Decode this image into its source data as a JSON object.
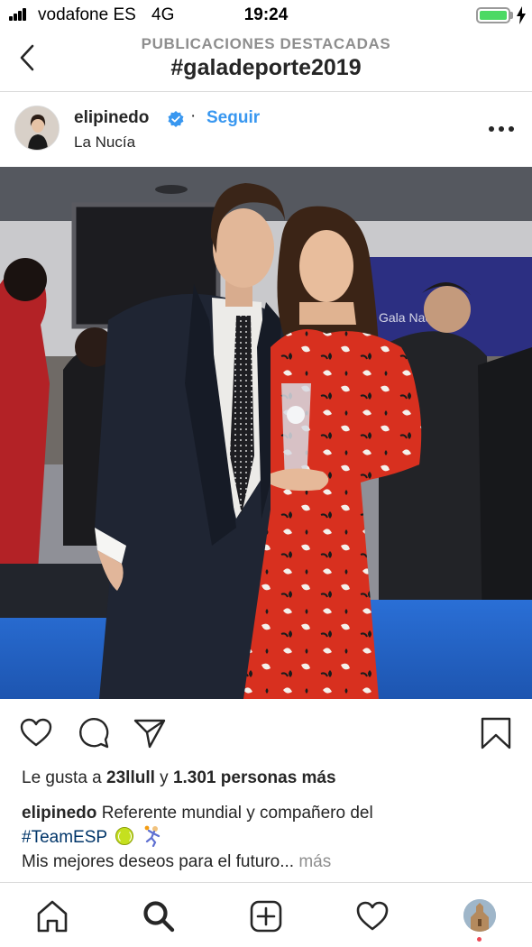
{
  "status_bar": {
    "carrier": "vodafone ES",
    "network": "4G",
    "time": "19:24",
    "battery_level": 1.0,
    "battery_color": "#4cd964"
  },
  "header": {
    "subtitle": "PUBLICACIONES DESTACADAS",
    "title": "#galadeporte2019",
    "back_icon": "chevron-left-icon"
  },
  "post": {
    "username": "elipinedo",
    "verified": true,
    "separator": "·",
    "follow_label": "Seguir",
    "location": "La Nucía",
    "more_icon": "ellipsis-icon",
    "image_alt": "Man in a dark suit and woman in a red floral dress holding an award at a gala",
    "actions": [
      "heart-icon",
      "comment-icon",
      "share-icon",
      "bookmark-icon"
    ],
    "likes": {
      "prefix": "Le gusta a",
      "first_user": "23llull",
      "connector": "y",
      "others": "1.301 personas más"
    },
    "caption": {
      "username": "elipinedo",
      "text": "Referente mundial y compañero del",
      "hashtag": "#TeamESP",
      "line2": "Mis mejores deseos para el futuro...",
      "more_label": "más"
    }
  },
  "tab_bar": {
    "items": [
      "home-icon",
      "search-icon",
      "add-post-icon",
      "activity-heart-icon",
      "profile-avatar"
    ],
    "notification_color": "#ed4956"
  },
  "colors": {
    "link_blue": "#3897f0",
    "hashtag_blue": "#003569",
    "muted_gray": "#8e8e8e",
    "text": "#262626"
  }
}
